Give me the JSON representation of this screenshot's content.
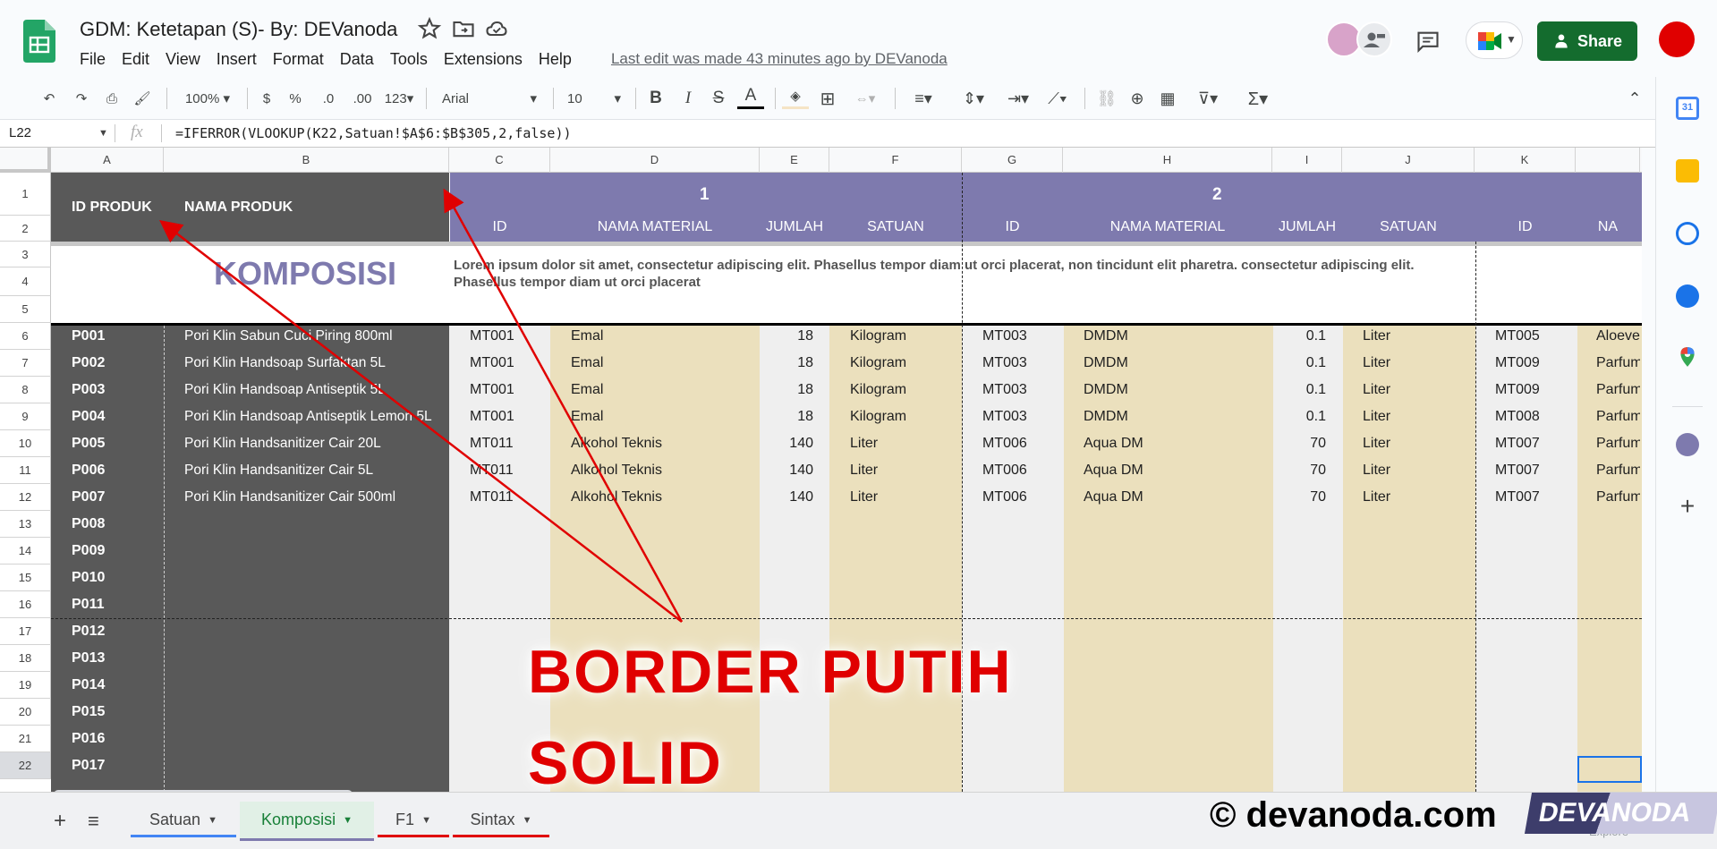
{
  "title": "GDM: Ketetapan (S)- By: DEVanoda",
  "menu": [
    "File",
    "Edit",
    "View",
    "Insert",
    "Format",
    "Data",
    "Tools",
    "Extensions",
    "Help"
  ],
  "last_edit": "Last edit was made 43 minutes ago by DEVanoda",
  "share_label": "Share",
  "toolbar": {
    "zoom": "100%",
    "currency": "$",
    "percent": "%",
    "dec_decrease": ".0",
    "dec_increase": ".00",
    "number_format": "123",
    "font": "Arial",
    "font_size": "10"
  },
  "namebox": "L22",
  "fx": "fx",
  "formula": "=IFERROR(VLOOKUP(K22,Satuan!$A$6:$B$305,2,false))",
  "colors": {
    "accent_green": "#146c2e",
    "header_dark": "#5a5a5a",
    "header_purple": "#7e7aae",
    "beige": "#ebe0bd",
    "annotation_red": "#e00000"
  },
  "columns": [
    "A",
    "B",
    "C",
    "D",
    "E",
    "F",
    "G",
    "H",
    "I",
    "J",
    "K"
  ],
  "rows": [
    "1",
    "2",
    "3",
    "4",
    "5",
    "6",
    "7",
    "8",
    "9",
    "10",
    "11",
    "12",
    "13",
    "14",
    "15",
    "16",
    "17",
    "18",
    "19",
    "20",
    "21",
    "22"
  ],
  "header": {
    "id_produk": "ID PRODUK",
    "nama_produk": "NAMA PRODUK",
    "group1": "1",
    "group2": "2",
    "sub": [
      "ID",
      "NAMA MATERIAL",
      "JUMLAH",
      "SATUAN",
      "ID",
      "NAMA MATERIAL",
      "JUMLAH",
      "SATUAN",
      "ID",
      "NA"
    ]
  },
  "komposisi": "KOMPOSISI",
  "lorem": "Lorem ipsum dolor sit amet, consectetur adipiscing elit. Phasellus tempor diam ut orci placerat, non tincidunt elit pharetra. consectetur adipiscing elit. Phasellus tempor diam ut orci placerat",
  "products": [
    [
      "P001",
      "Pori Klin Sabun Cuci Piring 800ml",
      "MT001",
      "Emal",
      "18",
      "Kilogram",
      "MT003",
      "DMDM",
      "0.1",
      "Liter",
      "MT005",
      "Aloeve"
    ],
    [
      "P002",
      "Pori Klin Handsoap Surfaktan 5L",
      "MT001",
      "Emal",
      "18",
      "Kilogram",
      "MT003",
      "DMDM",
      "0.1",
      "Liter",
      "MT009",
      "Parfum"
    ],
    [
      "P003",
      "Pori Klin Handsoap Antiseptik 5L",
      "MT001",
      "Emal",
      "18",
      "Kilogram",
      "MT003",
      "DMDM",
      "0.1",
      "Liter",
      "MT009",
      "Parfum"
    ],
    [
      "P004",
      "Pori Klin Handsoap Antiseptik Lemon 5L",
      "MT001",
      "Emal",
      "18",
      "Kilogram",
      "MT003",
      "DMDM",
      "0.1",
      "Liter",
      "MT008",
      "Parfum"
    ],
    [
      "P005",
      "Pori Klin Handsanitizer Cair 20L",
      "MT011",
      "Alkohol Teknis",
      "140",
      "Liter",
      "MT006",
      "Aqua DM",
      "70",
      "Liter",
      "MT007",
      "Parfum"
    ],
    [
      "P006",
      "Pori Klin Handsanitizer Cair 5L",
      "MT011",
      "Alkohol Teknis",
      "140",
      "Liter",
      "MT006",
      "Aqua DM",
      "70",
      "Liter",
      "MT007",
      "Parfum"
    ],
    [
      "P007",
      "Pori Klin Handsanitizer Cair 500ml",
      "MT011",
      "Alkohol Teknis",
      "140",
      "Liter",
      "MT006",
      "Aqua DM",
      "70",
      "Liter",
      "MT007",
      "Parfum"
    ],
    [
      "P008"
    ],
    [
      "P009"
    ],
    [
      "P010"
    ],
    [
      "P011"
    ],
    [
      "P012"
    ],
    [
      "P013"
    ],
    [
      "P014"
    ],
    [
      "P015"
    ],
    [
      "P016"
    ],
    [
      "P017"
    ]
  ],
  "overlay_line1": "BORDER PUTIH",
  "overlay_line2": "SOLID",
  "tabs": [
    "Satuan",
    "Komposisi",
    "F1",
    "Sintax"
  ],
  "watermark": "© devanoda.com",
  "watermark_logo": "DEVANODA",
  "explore": "Explore"
}
